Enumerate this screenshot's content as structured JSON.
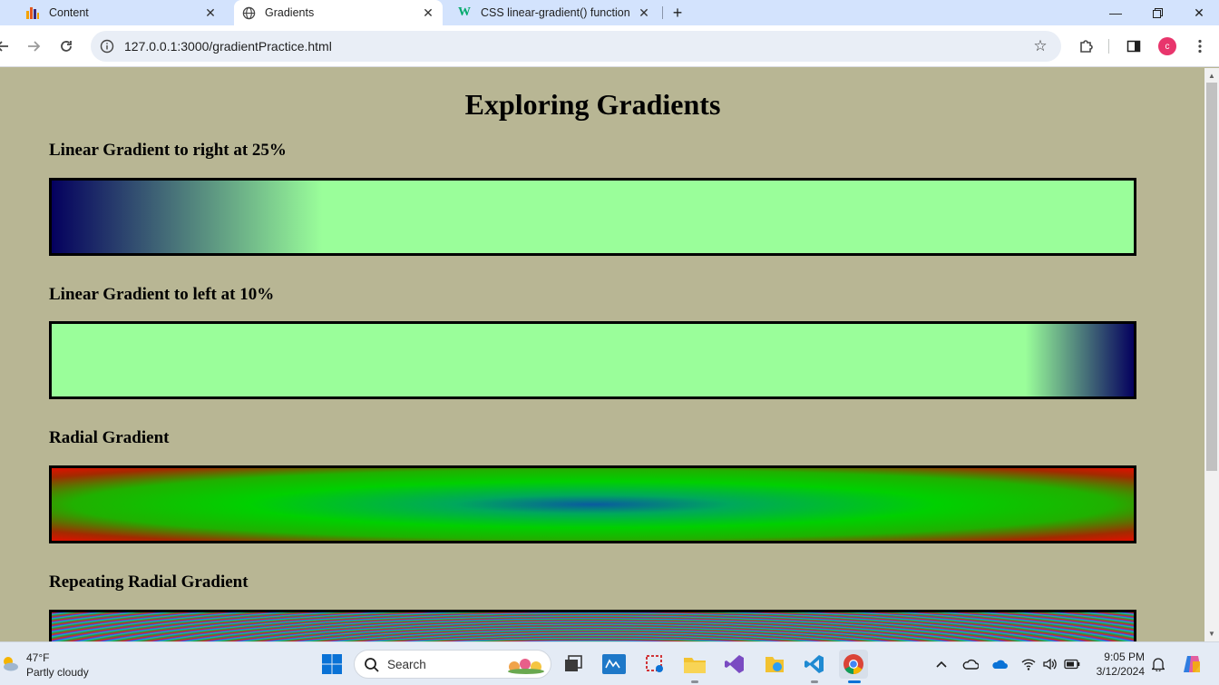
{
  "browser": {
    "tabs": [
      {
        "title": "Content",
        "icon": "bar-chart-icon",
        "active": false
      },
      {
        "title": "Gradients",
        "icon": "globe-icon",
        "active": true
      },
      {
        "title": "CSS linear-gradient() function",
        "icon": "w3schools-icon",
        "active": false
      }
    ],
    "url": "127.0.0.1:3000/gradientPractice.html"
  },
  "page": {
    "heading": "Exploring Gradients",
    "sections": [
      {
        "title": "Linear Gradient to right at 25%",
        "gradient": "linear",
        "direction": "to right",
        "stop": "25%",
        "colors": [
          "#04005e",
          "#9afe9a"
        ]
      },
      {
        "title": "Linear Gradient to left at 10%",
        "gradient": "linear",
        "direction": "to left",
        "stop": "10%",
        "colors": [
          "#04005e",
          "#9afe9a"
        ]
      },
      {
        "title": "Radial Gradient",
        "gradient": "radial",
        "colors": [
          "#0a5aa0",
          "#00d000",
          "#e01000"
        ]
      },
      {
        "title": "Repeating Radial Gradient",
        "gradient": "repeating-radial",
        "colors": [
          "#e02020",
          "#1ea040",
          "#20b8b0",
          "#3050ff"
        ]
      }
    ],
    "background": "#b8b694"
  },
  "taskbar": {
    "weather": {
      "temp": "47°F",
      "condition": "Partly cloudy"
    },
    "search_placeholder": "Search",
    "time": "9:05 PM",
    "date": "3/12/2024"
  }
}
